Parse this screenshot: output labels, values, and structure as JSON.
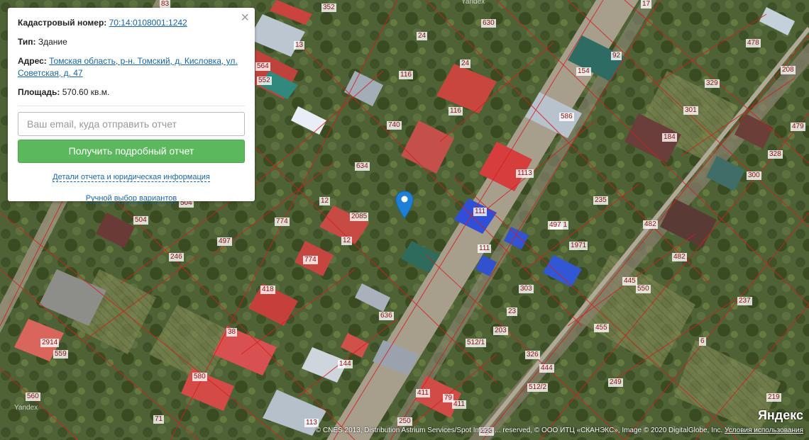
{
  "panel": {
    "cadastral_label": "Кадастровый номер:",
    "cadastral_value": "70:14:0108001:1242",
    "type_label": "Тип:",
    "type_value": "Здание",
    "address_label": "Адрес:",
    "address_value": "Томская область, р-н. Томский, д. Кисловка, ул. Советская, д. 47",
    "area_label": "Площадь:",
    "area_value": "570.60 кв.м.",
    "close_symbol": "×",
    "email_placeholder": "Ваш email, куда отправить отчет",
    "submit_label": "Получить подробный отчет",
    "details_link": "Детали отчета и юридическая информация",
    "manual_link": "Ручной выбор вариантов"
  },
  "map": {
    "parcel_labels": [
      "352",
      "83",
      "17",
      "630",
      "24",
      "13",
      "564",
      "552",
      "116",
      "24",
      "92",
      "154",
      "478",
      "208",
      "329",
      "740",
      "116",
      "586",
      "301",
      "184",
      "479",
      "328",
      "634",
      "1113",
      "12",
      "2085",
      "111",
      "300",
      "504",
      "497",
      "774",
      "235",
      "482",
      "12",
      "1971",
      "246",
      "504",
      "497",
      "774",
      "111",
      "1971",
      "482",
      "418",
      "303",
      "445",
      "550",
      "237",
      "636",
      "23",
      "38",
      "2914",
      "203",
      "455",
      "6",
      "559",
      "512/1",
      "326",
      "444",
      "144",
      "512/2",
      "249",
      "580",
      "560",
      "411",
      "79",
      "411",
      "219",
      "71",
      "228",
      "250",
      "113"
    ],
    "yandex_logo": "Яндекс",
    "yandex_watermark": "Yandex",
    "copyright_text": "© CNES 2013, Distribution Astrium Services/Spot Image ... reserved, © ООО ИТЦ «СКАНЭКС», Image © 2020 DigitalGlobe, Inc.",
    "terms_link": "Условия использования",
    "marker_color": "#1e7fd6"
  }
}
